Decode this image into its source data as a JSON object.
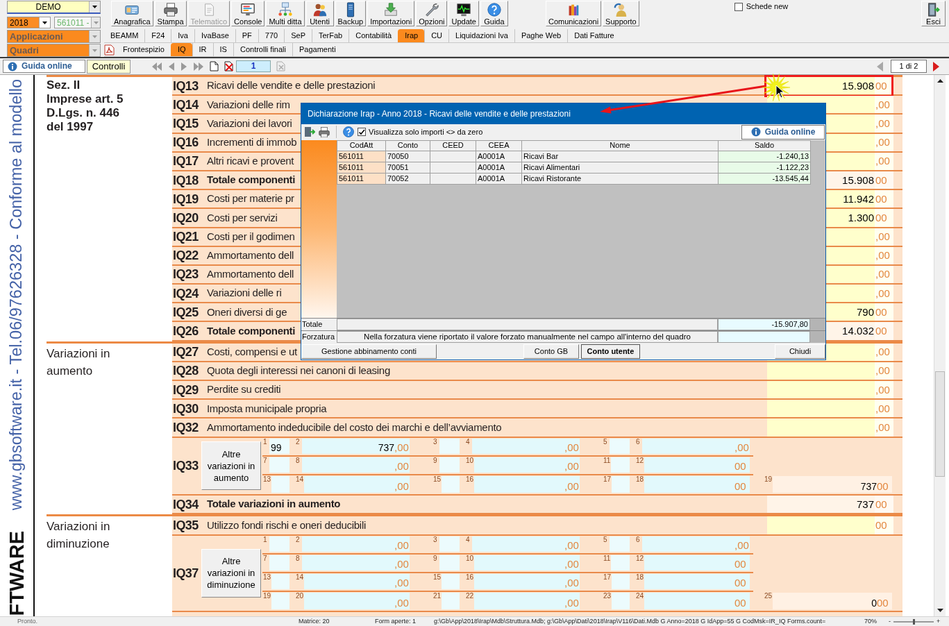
{
  "toolbar": {
    "company": "DEMO",
    "year": "2018",
    "activity": "561011 -",
    "buttons": [
      {
        "label": "Anagrafica",
        "disabled": false
      },
      {
        "label": "Stampa",
        "disabled": false
      },
      {
        "label": "Telematico",
        "disabled": true
      },
      {
        "label": "Console",
        "disabled": false
      },
      {
        "label": "Multi ditta",
        "disabled": false
      },
      {
        "label": "Utenti",
        "disabled": false
      },
      {
        "label": "Backup",
        "disabled": false
      },
      {
        "label": "Importazioni",
        "disabled": false
      },
      {
        "label": "Opzioni",
        "disabled": false
      },
      {
        "label": "Update",
        "disabled": false
      },
      {
        "label": "Guida",
        "disabled": false
      }
    ],
    "extra_buttons": [
      {
        "label": "Comunicazioni"
      },
      {
        "label": "Supporto"
      }
    ],
    "new_tabs_checkbox": {
      "label": "Schede new",
      "checked": false
    },
    "exit_button": {
      "label": "Esci"
    }
  },
  "applications": {
    "combo": "Applicazioni",
    "tabs": [
      {
        "label": "BEAMM",
        "selected": false
      },
      {
        "label": "F24",
        "selected": false
      },
      {
        "label": "Iva",
        "selected": false
      },
      {
        "label": "IvaBase",
        "selected": false
      },
      {
        "label": "PF",
        "selected": false
      },
      {
        "label": "770",
        "selected": false
      },
      {
        "label": "SeP",
        "selected": false
      },
      {
        "label": "TerFab",
        "selected": false
      },
      {
        "label": "Contabilità",
        "selected": false
      },
      {
        "label": "Irap",
        "selected": true
      },
      {
        "label": "CU",
        "selected": false
      },
      {
        "label": "Liquidazioni Iva",
        "selected": false
      },
      {
        "label": "Paghe Web",
        "selected": false
      },
      {
        "label": "Dati Fatture",
        "selected": false
      }
    ]
  },
  "frames": {
    "combo": "Quadri",
    "tabs": [
      {
        "label": "Frontespizio",
        "selected": false
      },
      {
        "label": "IQ",
        "selected": true
      },
      {
        "label": "IR",
        "selected": false
      },
      {
        "label": "IS",
        "selected": false
      },
      {
        "label": "Controlli finali",
        "selected": false
      },
      {
        "label": "Pagamenti",
        "selected": false
      }
    ]
  },
  "navigation": {
    "help_button": "Guida online",
    "checks_button": "Controlli",
    "page": "1",
    "pager": "1 di 2"
  },
  "form": {
    "side_text": "www.gbsoftware.it - Tel.06/97626328 - Conforme al modello",
    "logo_text": "FTWARE",
    "sections": [
      {
        "title": "Sez. II\nImprese art. 5\nD.Lgs. n. 446\ndel 1997",
        "bold": true,
        "rows": [
          {
            "code": "IQ13",
            "kind": "input",
            "label": "Ricavi delle vendite e delle prestazioni",
            "value": "15.908",
            "decimals": "00",
            "highlighted": true
          },
          {
            "code": "IQ14",
            "kind": "input",
            "label": "Variazioni delle rim",
            "decimals": ",00",
            "highlighted": false
          },
          {
            "code": "IQ15",
            "kind": "input",
            "label": "Variazioni dei lavori",
            "decimals": ",00",
            "highlighted": false
          },
          {
            "code": "IQ16",
            "kind": "input",
            "label": "Incrementi di immob",
            "decimals": ",00",
            "highlighted": false
          },
          {
            "code": "IQ17",
            "kind": "input",
            "label": "Altri ricavi e provent",
            "decimals": ",00",
            "highlighted": false
          },
          {
            "code": "IQ18",
            "kind": "total",
            "label": "Totale componenti",
            "value": "15.908",
            "decimals": "00",
            "highlighted": false
          },
          {
            "code": "IQ19",
            "kind": "input",
            "label": "Costi per materie pr",
            "value": "11.942",
            "decimals": "00",
            "highlighted": false
          },
          {
            "code": "IQ20",
            "kind": "input",
            "label": "Costi per servizi",
            "value": "1.300",
            "decimals": "00",
            "highlighted": false
          },
          {
            "code": "IQ21",
            "kind": "input",
            "label": "Costi per il godimen",
            "decimals": ",00",
            "highlighted": false
          },
          {
            "code": "IQ22",
            "kind": "input",
            "label": "Ammortamento dell",
            "decimals": ",00",
            "highlighted": false
          },
          {
            "code": "IQ23",
            "kind": "input",
            "label": "Ammortamento dell",
            "decimals": ",00",
            "highlighted": false
          },
          {
            "code": "IQ24",
            "kind": "input",
            "label": "Variazioni delle ri",
            "decimals": ",00",
            "highlighted": false
          },
          {
            "code": "IQ25",
            "kind": "input",
            "label": "Oneri diversi di ge",
            "value": "790",
            "decimals": "00",
            "highlighted": false
          },
          {
            "code": "IQ26",
            "kind": "total",
            "label": "Totale componenti",
            "value": "14.032",
            "decimals": "00",
            "highlighted": false
          }
        ]
      },
      {
        "title": "Variazioni in\naumento",
        "bold": false,
        "rows": [
          {
            "code": "IQ27",
            "kind": "input",
            "label": "Costi, compensi e ut",
            "decimals": ",00",
            "highlighted": false
          },
          {
            "code": "IQ28",
            "kind": "input",
            "label": "Quota degli interessi nei canoni di leasing",
            "decimals": ",00",
            "highlighted": false
          },
          {
            "code": "IQ29",
            "kind": "input",
            "label": "Perdite su crediti",
            "decimals": ",00",
            "highlighted": false
          },
          {
            "code": "IQ30",
            "kind": "input",
            "label": "Imposta municipale propria",
            "decimals": ",00",
            "highlighted": false
          },
          {
            "code": "IQ32",
            "kind": "input",
            "label": "Ammortamento indeducibile del costo dei marchi e dell’avviamento",
            "decimals": ",00",
            "highlighted": false
          },
          {
            "code": "IQ33",
            "kind": "grid",
            "button": "Altre variazioni in aumento",
            "highlighted": false,
            "lines": [
              [
                {
                  "number": "1",
                  "kind": "code",
                  "value": "99"
                },
                {
                  "number": "2",
                  "kind": "amount",
                  "value": "737",
                  "decimals": ",00"
                },
                {
                  "number": "3",
                  "kind": "code"
                },
                {
                  "number": "4",
                  "kind": "amount",
                  "decimals": ",00"
                },
                {
                  "number": "5",
                  "kind": "code"
                },
                {
                  "number": "6",
                  "kind": "amount",
                  "decimals": ",00"
                }
              ],
              [
                {
                  "number": "7",
                  "kind": "code"
                },
                {
                  "number": "8",
                  "kind": "amount",
                  "decimals": ",00"
                },
                {
                  "number": "9",
                  "kind": "code"
                },
                {
                  "number": "10",
                  "kind": "amount",
                  "decimals": ",00"
                },
                {
                  "number": "11",
                  "kind": "code"
                },
                {
                  "number": "12",
                  "kind": "amount",
                  "decimals": "00"
                }
              ],
              [
                {
                  "number": "13",
                  "kind": "code"
                },
                {
                  "number": "14",
                  "kind": "amount",
                  "decimals": ",00"
                },
                {
                  "number": "15",
                  "kind": "code"
                },
                {
                  "number": "16",
                  "kind": "amount",
                  "decimals": ",00"
                },
                {
                  "number": "17",
                  "kind": "code"
                },
                {
                  "number": "18",
                  "kind": "amount",
                  "decimals": "00"
                }
              ]
            ],
            "total": {
              "number": "19",
              "value": "737",
              "decimals": "00"
            }
          },
          {
            "code": "IQ34",
            "kind": "total",
            "label": "Totale variazioni in aumento",
            "value": "737",
            "decimals": "00",
            "highlighted": false
          }
        ]
      },
      {
        "title": "Variazioni in\ndiminuzione",
        "bold": false,
        "rows": [
          {
            "code": "IQ35",
            "kind": "input",
            "label": "Utilizzo fondi rischi e oneri deducibili",
            "decimals": "00",
            "highlighted": false
          },
          {
            "code": "IQ37",
            "kind": "grid",
            "button": "Altre variazioni in diminuzione",
            "highlighted": false,
            "lines": [
              [
                {
                  "number": "1",
                  "kind": "code"
                },
                {
                  "number": "2",
                  "kind": "amount",
                  "decimals": ",00"
                },
                {
                  "number": "3",
                  "kind": "code"
                },
                {
                  "number": "4",
                  "kind": "amount",
                  "decimals": ",00"
                },
                {
                  "number": "5",
                  "kind": "code"
                },
                {
                  "number": "6",
                  "kind": "amount",
                  "decimals": ",00"
                }
              ],
              [
                {
                  "number": "7",
                  "kind": "code"
                },
                {
                  "number": "8",
                  "kind": "amount",
                  "decimals": ",00"
                },
                {
                  "number": "9",
                  "kind": "code"
                },
                {
                  "number": "10",
                  "kind": "amount",
                  "decimals": ",00"
                },
                {
                  "number": "11",
                  "kind": "code"
                },
                {
                  "number": "12",
                  "kind": "amount",
                  "decimals": "00"
                }
              ],
              [
                {
                  "number": "13",
                  "kind": "code"
                },
                {
                  "number": "14",
                  "kind": "amount",
                  "decimals": ",00"
                },
                {
                  "number": "15",
                  "kind": "code"
                },
                {
                  "number": "16",
                  "kind": "amount",
                  "decimals": ",00"
                },
                {
                  "number": "17",
                  "kind": "code"
                },
                {
                  "number": "18",
                  "kind": "amount",
                  "decimals": "00"
                }
              ],
              [
                {
                  "number": "19",
                  "kind": "code"
                },
                {
                  "number": "20",
                  "kind": "amount",
                  "decimals": ",00"
                },
                {
                  "number": "21",
                  "kind": "code"
                },
                {
                  "number": "22",
                  "kind": "amount",
                  "decimals": ",00"
                },
                {
                  "number": "23",
                  "kind": "code"
                },
                {
                  "number": "24",
                  "kind": "amount",
                  "decimals": "00"
                }
              ]
            ],
            "total": {
              "number": "25",
              "value": "0",
              "decimals": "00"
            }
          }
        ]
      }
    ]
  },
  "dialog": {
    "title": "Dichiarazione Irap - Anno 2018 - Ricavi delle vendite e delle prestazioni",
    "filter": {
      "label": "Visualizza solo importi <> da zero",
      "checked": true
    },
    "help_button": "Guida online",
    "columns": [
      "CodAtt",
      "Conto",
      "CEED",
      "CEEA",
      "Nome",
      "Saldo"
    ],
    "rows": [
      {
        "codatt": "561011",
        "conto": "70050",
        "ceea": "A0001A",
        "nome": "Ricavi Bar",
        "saldo": "-1.240,13"
      },
      {
        "codatt": "561011",
        "conto": "70051",
        "ceea": "A0001A",
        "nome": "Ricavi Alimentari",
        "saldo": "-1.122,23"
      },
      {
        "codatt": "561011",
        "conto": "70052",
        "ceea": "A0001A",
        "nome": "Ricavi Ristorante",
        "saldo": "-13.545,44"
      }
    ],
    "total_label": "Totale",
    "total": "-15.907,80",
    "override_label": "Forzatura",
    "override_note": "Nella forzatura viene riportato il valore forzato manualmente nel campo all'interno del quadro",
    "manage_button": "Gestione abbinamento conti",
    "view_buttons": [
      {
        "label": "Conto GB",
        "selected": false
      },
      {
        "label": "Conto utente",
        "selected": true
      }
    ],
    "close_button": "Chiudi"
  },
  "status_bar": {
    "state": "Pronto.",
    "matrix": "Matrice: 20",
    "open_forms": "Form aperte: 1",
    "info": "g:\\Gb\\App\\2018\\Irap\\Mdb\\Struttura.Mdb; g:\\Gb\\App\\Dati\\2018\\Irap\\V116\\Dati.Mdb G Anno=2018 G IdApp=55 G CodMsk=IR_IQ Forms.count=",
    "zoom": "70%",
    "zoom_out": "-",
    "zoom_in": "+",
    "zoom_slider": {
      "level": 0.5
    }
  }
}
